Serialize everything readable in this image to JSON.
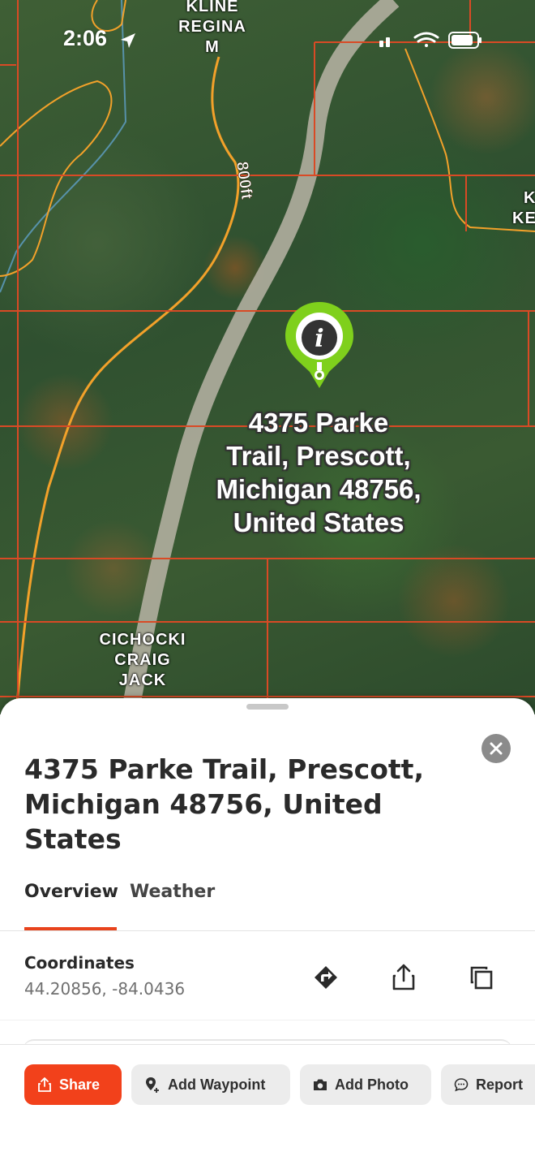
{
  "status_bar": {
    "time": "2:06"
  },
  "map": {
    "labels": {
      "owner_top": [
        "KLINE",
        "REGINA",
        "M"
      ],
      "owner_right": [
        "K",
        "KE"
      ],
      "owner_bottom": [
        "CICHOCKI",
        "CRAIG",
        "JACK"
      ],
      "contour": "800ft"
    },
    "pin_label_lines": [
      "4375 Parke",
      "Trail, Prescott,",
      "Michigan 48756,",
      "United States"
    ],
    "pin_icon": "info-icon",
    "colors": {
      "parcel_lines": "#d94a25",
      "contour_lines": "#f2a12a",
      "pin": "#7fd01c",
      "road": "#b9b4a6"
    }
  },
  "sheet": {
    "title": "4375 Parke Trail, Prescott, Michigan 48756, United States",
    "tabs": [
      {
        "label": "Overview",
        "active": true
      },
      {
        "label": "Weather",
        "active": false
      }
    ],
    "coordinates": {
      "label": "Coordinates",
      "value": "44.20856, -84.0436"
    },
    "row_icons": [
      "directions-icon",
      "share-icon",
      "copy-icon"
    ],
    "actions": [
      {
        "label": "Share",
        "icon": "share-icon"
      },
      {
        "label": "Add Waypoint",
        "icon": "add-waypoint-icon"
      },
      {
        "label": "Add Photo",
        "icon": "camera-icon"
      },
      {
        "label": "Report",
        "icon": "chat-bubble-icon"
      }
    ],
    "accent_color": "#f2411b"
  }
}
